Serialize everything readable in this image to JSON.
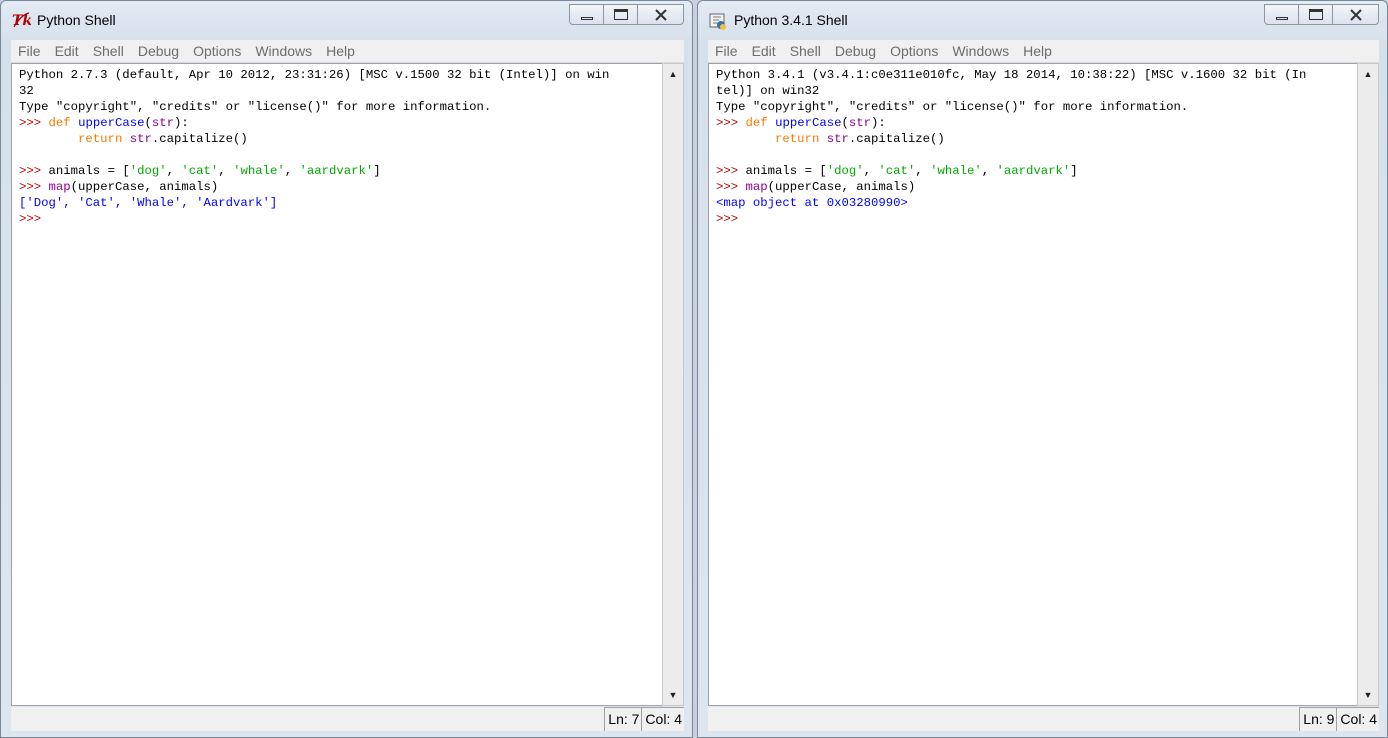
{
  "windows": [
    {
      "title": "Python Shell",
      "menu": [
        "File",
        "Edit",
        "Shell",
        "Debug",
        "Options",
        "Windows",
        "Help"
      ],
      "status": {
        "line": "Ln: 7",
        "col": "Col: 4"
      },
      "lines": [
        [
          {
            "t": "Python 2.7.3 (default, Apr 10 2012, 23:31:26) [MSC v.1500 32 bit (Intel)] on win",
            "c": "plain"
          }
        ],
        [
          {
            "t": "32",
            "c": "plain"
          }
        ],
        [
          {
            "t": "Type \"copyright\", \"credits\" or \"license()\" for more information.",
            "c": "plain"
          }
        ],
        [
          {
            "t": ">>> ",
            "c": "prompt"
          },
          {
            "t": "def ",
            "c": "kw"
          },
          {
            "t": "upperCase",
            "c": "def"
          },
          {
            "t": "(",
            "c": "plain"
          },
          {
            "t": "str",
            "c": "builtin"
          },
          {
            "t": "):",
            "c": "plain"
          }
        ],
        [
          {
            "t": "        ",
            "c": "plain"
          },
          {
            "t": "return ",
            "c": "kw"
          },
          {
            "t": "str",
            "c": "builtin"
          },
          {
            "t": ".capitalize()",
            "c": "plain"
          }
        ],
        [
          {
            "t": "",
            "c": "plain"
          }
        ],
        [
          {
            "t": ">>> ",
            "c": "prompt"
          },
          {
            "t": "animals = [",
            "c": "plain"
          },
          {
            "t": "'dog'",
            "c": "str"
          },
          {
            "t": ", ",
            "c": "plain"
          },
          {
            "t": "'cat'",
            "c": "str"
          },
          {
            "t": ", ",
            "c": "plain"
          },
          {
            "t": "'whale'",
            "c": "str"
          },
          {
            "t": ", ",
            "c": "plain"
          },
          {
            "t": "'aardvark'",
            "c": "str"
          },
          {
            "t": "]",
            "c": "plain"
          }
        ],
        [
          {
            "t": ">>> ",
            "c": "prompt"
          },
          {
            "t": "map",
            "c": "builtin"
          },
          {
            "t": "(upperCase, animals)",
            "c": "plain"
          }
        ],
        [
          {
            "t": "['Dog', 'Cat', 'Whale', 'Aardvark']",
            "c": "out"
          }
        ],
        [
          {
            "t": ">>> ",
            "c": "prompt"
          }
        ]
      ]
    },
    {
      "title": "Python 3.4.1 Shell",
      "menu": [
        "File",
        "Edit",
        "Shell",
        "Debug",
        "Options",
        "Windows",
        "Help"
      ],
      "status": {
        "line": "Ln: 9",
        "col": "Col: 4"
      },
      "lines": [
        [
          {
            "t": "Python 3.4.1 (v3.4.1:c0e311e010fc, May 18 2014, 10:38:22) [MSC v.1600 32 bit (In",
            "c": "plain"
          }
        ],
        [
          {
            "t": "tel)] on win32",
            "c": "plain"
          }
        ],
        [
          {
            "t": "Type \"copyright\", \"credits\" or \"license()\" for more information.",
            "c": "plain"
          }
        ],
        [
          {
            "t": ">>> ",
            "c": "prompt"
          },
          {
            "t": "def ",
            "c": "kw"
          },
          {
            "t": "upperCase",
            "c": "def"
          },
          {
            "t": "(",
            "c": "plain"
          },
          {
            "t": "str",
            "c": "builtin"
          },
          {
            "t": "):",
            "c": "plain"
          }
        ],
        [
          {
            "t": "        ",
            "c": "plain"
          },
          {
            "t": "return ",
            "c": "kw"
          },
          {
            "t": "str",
            "c": "builtin"
          },
          {
            "t": ".capitalize()",
            "c": "plain"
          }
        ],
        [
          {
            "t": "",
            "c": "plain"
          }
        ],
        [
          {
            "t": ">>> ",
            "c": "prompt"
          },
          {
            "t": "animals = [",
            "c": "plain"
          },
          {
            "t": "'dog'",
            "c": "str"
          },
          {
            "t": ", ",
            "c": "plain"
          },
          {
            "t": "'cat'",
            "c": "str"
          },
          {
            "t": ", ",
            "c": "plain"
          },
          {
            "t": "'whale'",
            "c": "str"
          },
          {
            "t": ", ",
            "c": "plain"
          },
          {
            "t": "'aardvark'",
            "c": "str"
          },
          {
            "t": "]",
            "c": "plain"
          }
        ],
        [
          {
            "t": ">>> ",
            "c": "prompt"
          },
          {
            "t": "map",
            "c": "builtin"
          },
          {
            "t": "(upperCase, animals)",
            "c": "plain"
          }
        ],
        [
          {
            "t": "<map object at 0x03280990>",
            "c": "out"
          }
        ],
        [
          {
            "t": ">>> ",
            "c": "prompt"
          }
        ]
      ]
    }
  ],
  "icons": {
    "left_app": "tk-feather-icon",
    "right_app": "python-shell-icon"
  },
  "colors": {
    "prompt": "#c00000",
    "keyword": "#ff7700",
    "definition": "#0000ff",
    "string": "#00aa00",
    "output": "#0000ff",
    "builtin": "#900090"
  }
}
